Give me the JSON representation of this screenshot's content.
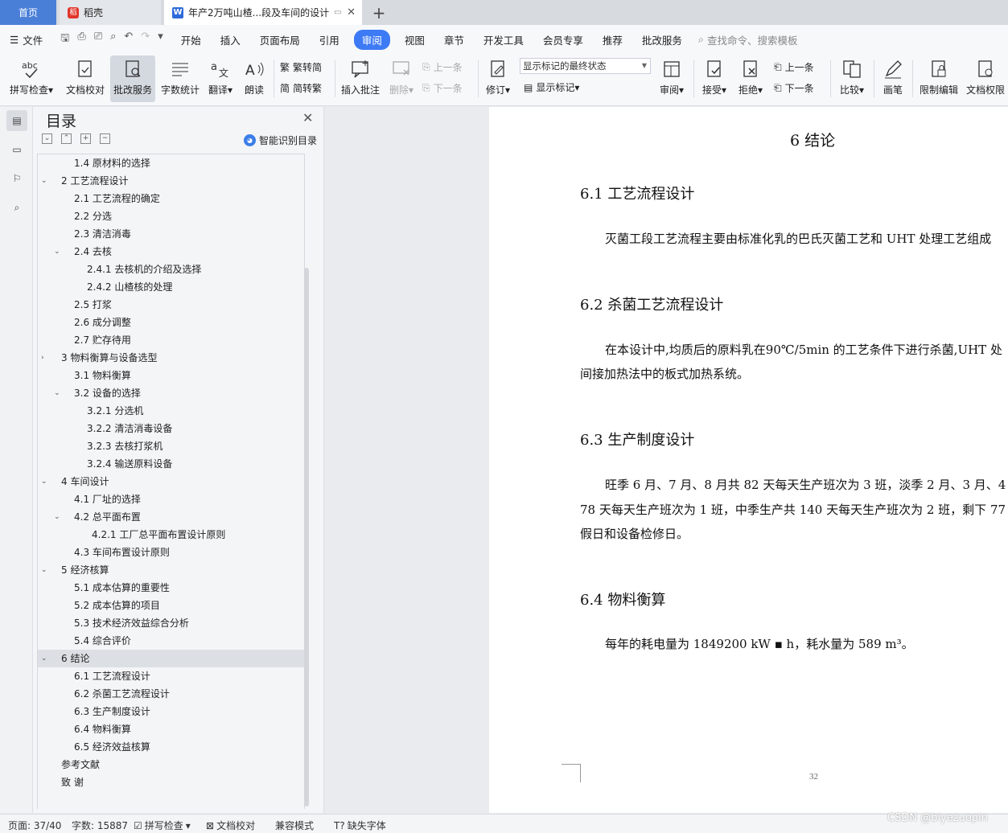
{
  "tabs": {
    "home": "首页",
    "daoke": "稻壳",
    "doc": "年产2万吨山楂...段及车间的设计"
  },
  "menu": {
    "file": "文件",
    "items": [
      "开始",
      "插入",
      "页面布局",
      "引用",
      "审阅",
      "视图",
      "章节",
      "开发工具",
      "会员专享",
      "推荐",
      "批改服务"
    ],
    "active": "审阅",
    "search_placeholder": "查找命令、搜索模板"
  },
  "ribbon": {
    "spell_check": "拼写检查",
    "doc_proof": "文档校对",
    "review_service": "批改服务",
    "word_count": "字数统计",
    "translate": "翻译",
    "read_aloud": "朗读",
    "to_traditional": "繁转简",
    "to_simplified": "简转繁",
    "insert_comment": "插入批注",
    "delete": "删除",
    "prev": "上一条",
    "next": "下一条",
    "track": "修订",
    "markup_state": "显示标记的最终状态",
    "show_markup": "显示标记",
    "review": "审阅",
    "accept": "接受",
    "reject": "拒绝",
    "prev2": "上一条",
    "next2": "下一条",
    "compare": "比较",
    "pen": "画笔",
    "restrict_edit": "限制编辑",
    "doc_perm": "文档权限"
  },
  "toc": {
    "title": "目录",
    "smart": "智能识别目录",
    "items": [
      {
        "label": "1.4 原材料的选择",
        "level": 2,
        "tog": ""
      },
      {
        "label": "2 工艺流程设计",
        "level": 1,
        "tog": "v"
      },
      {
        "label": "2.1 工艺流程的确定",
        "level": 2,
        "tog": ""
      },
      {
        "label": "2.2 分选",
        "level": 2,
        "tog": ""
      },
      {
        "label": "2.3 清洁消毒",
        "level": 2,
        "tog": ""
      },
      {
        "label": "2.4 去核",
        "level": 2,
        "tog": "v"
      },
      {
        "label": "2.4.1 去核机的介绍及选择",
        "level": 3,
        "tog": ""
      },
      {
        "label": "2.4.2 山楂核的处理",
        "level": 3,
        "tog": ""
      },
      {
        "label": "2.5 打浆",
        "level": 2,
        "tog": ""
      },
      {
        "label": "2.6 成分调整",
        "level": 2,
        "tog": ""
      },
      {
        "label": "2.7 贮存待用",
        "level": 2,
        "tog": ""
      },
      {
        "label": "3  物料衡算与设备选型",
        "level": 1,
        "tog": ">"
      },
      {
        "label": "3.1 物料衡算",
        "level": 2,
        "tog": ""
      },
      {
        "label": "3.2 设备的选择",
        "level": 2,
        "tog": "v"
      },
      {
        "label": "3.2.1 分选机",
        "level": 3,
        "tog": ""
      },
      {
        "label": "3.2.2 清洁消毒设备",
        "level": 3,
        "tog": ""
      },
      {
        "label": "3.2.3 去核打浆机",
        "level": 3,
        "tog": ""
      },
      {
        "label": "3.2.4 输送原料设备",
        "level": 3,
        "tog": ""
      },
      {
        "label": "4 车间设计",
        "level": 1,
        "tog": "v"
      },
      {
        "label": "4.1  厂址的选择",
        "level": 2,
        "tog": ""
      },
      {
        "label": "4.2  总平面布置",
        "level": 2,
        "tog": "v"
      },
      {
        "label": "4.2.1 工厂总平面布置设计原则",
        "level": 4,
        "tog": ""
      },
      {
        "label": "4.3  车间布置设计原则",
        "level": 2,
        "tog": ""
      },
      {
        "label": "5 经济核算",
        "level": 1,
        "tog": "v"
      },
      {
        "label": "5.1 成本估算的重要性",
        "level": 2,
        "tog": ""
      },
      {
        "label": "5.2 成本估算的项目",
        "level": 2,
        "tog": ""
      },
      {
        "label": "5.3 技术经济效益综合分析",
        "level": 2,
        "tog": ""
      },
      {
        "label": "5.4 综合评价",
        "level": 2,
        "tog": ""
      },
      {
        "label": "6 结论",
        "level": 1,
        "tog": "v",
        "selected": true
      },
      {
        "label": "6.1 工艺流程设计",
        "level": 2,
        "tog": ""
      },
      {
        "label": "6.2 杀菌工艺流程设计",
        "level": 2,
        "tog": ""
      },
      {
        "label": "6.3 生产制度设计",
        "level": 2,
        "tog": ""
      },
      {
        "label": "6.4 物料衡算",
        "level": 2,
        "tog": ""
      },
      {
        "label": "6.5 经济效益核算",
        "level": 2,
        "tog": ""
      },
      {
        "label": "参考文献",
        "level": 1,
        "tog": ""
      },
      {
        "label": "致    谢",
        "level": 1,
        "tog": ""
      }
    ]
  },
  "doc": {
    "title": "6 结论",
    "s1_head": "6.1 工艺流程设计",
    "s1_p1": "灭菌工段工艺流程主要由标准化乳的巴氏灭菌工艺和 UHT 处理工艺组成",
    "s2_head": "6.2 杀菌工艺流程设计",
    "s2_p1": "在本设计中,均质后的原料乳在90℃/5min 的工艺条件下进行杀菌,UHT 处",
    "s2_p2": "间接加热法中的板式加热系统。",
    "s3_head": "6.3 生产制度设计",
    "s3_p1": "旺季 6 月、7 月、8 月共 82 天每天生产班次为 3 班，淡季  2 月、3 月、4",
    "s3_p2": "78 天每天生产班次为 1 班，中季生产共 140 天每天生产班次为 2 班，剩下 77",
    "s3_p3": "假日和设备检修日。",
    "s4_head": "6.4 物料衡算",
    "s4_p1": "每年的耗电量为 1849200 kW ▪ h，耗水量为 589 m³。",
    "page_number": "32"
  },
  "status": {
    "page": "页面: 37/40",
    "words": "字数: 15887",
    "spell": "拼写检查",
    "proof": "文档校对",
    "compat": "兼容模式",
    "missing_font": "缺失字体"
  },
  "watermark": "CSDN @biyezuopin"
}
